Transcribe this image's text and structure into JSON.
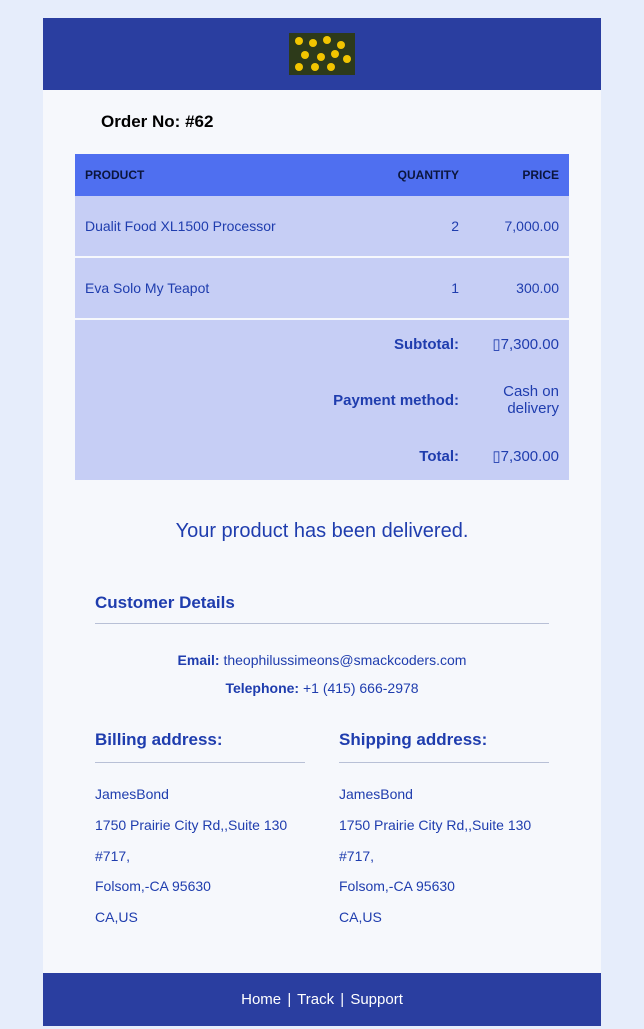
{
  "order": {
    "label": "Order No:",
    "number": "#62"
  },
  "table": {
    "headers": {
      "product": "PRODUCT",
      "quantity": "QUANTITY",
      "price": "PRICE"
    },
    "items": [
      {
        "name": "Dualit Food XL1500 Processor",
        "qty": "2",
        "price": "7,000.00"
      },
      {
        "name": "Eva Solo My Teapot",
        "qty": "1",
        "price": "300.00"
      }
    ],
    "summary": {
      "subtotal_label": "Subtotal:",
      "subtotal_value": "▯7,300.00",
      "payment_label": "Payment method:",
      "payment_value": "Cash on delivery",
      "total_label": "Total:",
      "total_value": "▯7,300.00"
    }
  },
  "delivered_msg": "Your product has been delivered.",
  "customer": {
    "title": "Customer Details",
    "email_label": "Email:",
    "email": "theophilussimeons@smackcoders.com",
    "tel_label": "Telephone:",
    "tel": "+1 (415) 666-2978"
  },
  "billing": {
    "title": "Billing address:",
    "name": "JamesBond",
    "line1": "1750 Prairie City Rd,,Suite 130 #717,",
    "line2": "Folsom,-CA 95630",
    "line3": "CA,US"
  },
  "shipping": {
    "title": "Shipping address:",
    "name": "JamesBond",
    "line1": "1750 Prairie City Rd,,Suite 130 #717,",
    "line2": "Folsom,-CA 95630",
    "line3": "CA,US"
  },
  "footer": {
    "home": "Home",
    "track": "Track",
    "support": "Support",
    "sep": "|"
  }
}
